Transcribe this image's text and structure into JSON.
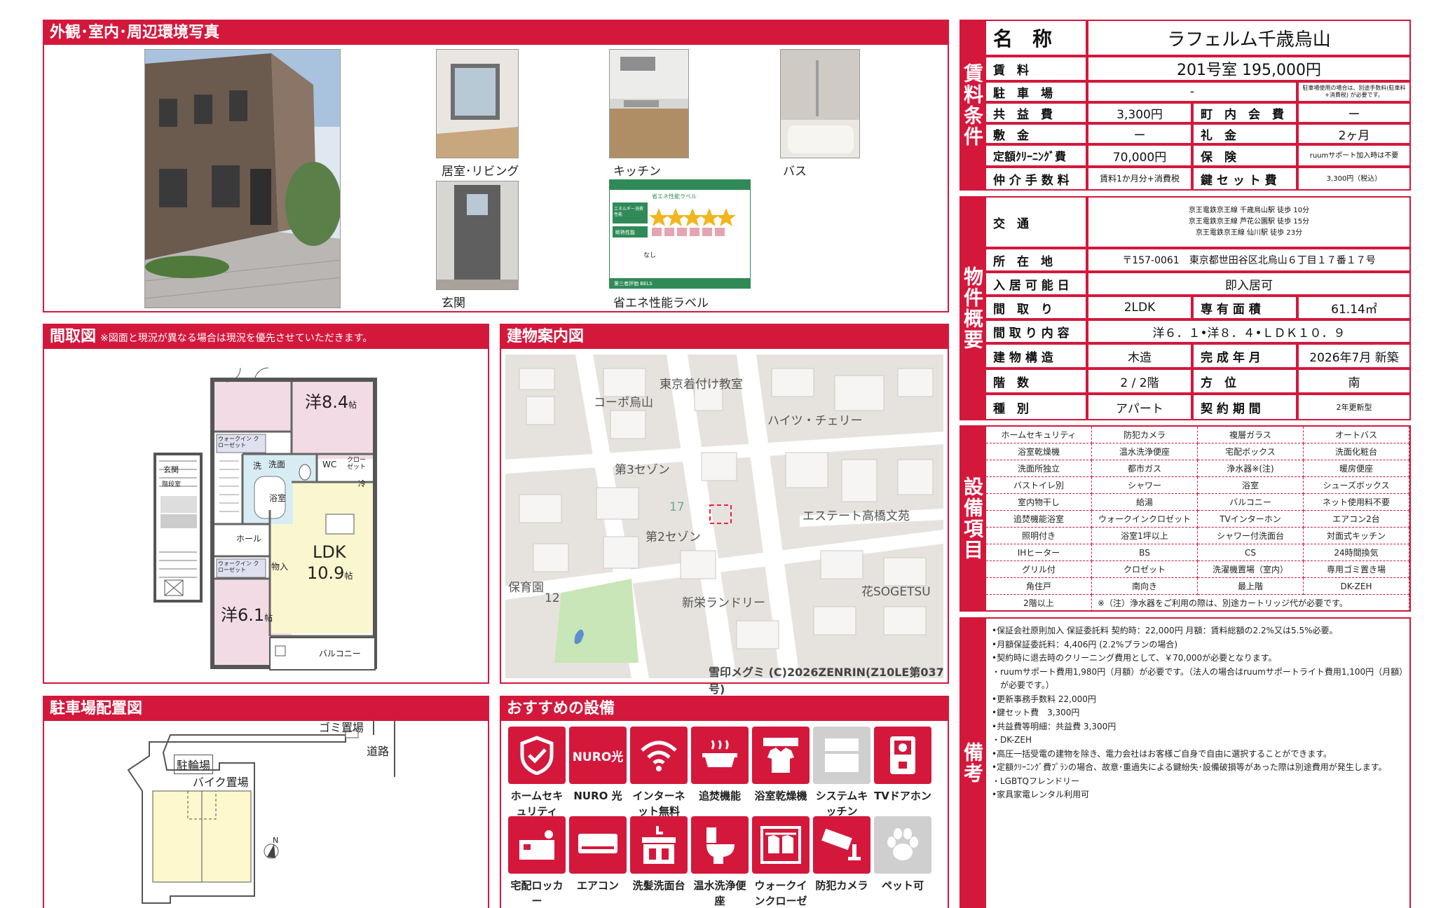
{
  "sections": {
    "photos_title": "外観･室内･周辺環境写真",
    "floorplan_title": "間取図",
    "floorplan_note": "※図面と現況が異なる場合は現況を優先させていただきます。",
    "map_title": "建物案内図",
    "parking_title": "駐車場配置図",
    "facilities_title": "おすすめの設備"
  },
  "photo_captions": {
    "living": "居室･リビング",
    "kitchen": "キッチン",
    "bath": "バス",
    "entrance": "玄関",
    "energy": "省エネ性能ラベル"
  },
  "energy_label": {
    "title": "省エネ性能ラベル",
    "row1": "エネルギー消費性能",
    "row2": "断熱性能",
    "none": "なし",
    "footer": "第三者評価 BELS"
  },
  "floorplan": {
    "room1": "洋8.4",
    "room1_unit": "帖",
    "room2": "洋6.1",
    "room2_unit": "帖",
    "ldk": "LDK",
    "ldk_size": "10.9",
    "ldk_unit": "帖",
    "wic1": "ウォークイン クローゼット",
    "wic2": "ウォークイン クローゼット",
    "wash": "洗",
    "basin": "洗面",
    "wc": "WC",
    "closet": "クロー ゼット",
    "fridge": "冷",
    "bath": "浴室",
    "hall": "ホール",
    "storage": "物入",
    "balcony": "バルコニー",
    "entrance": "玄関",
    "stairs": "階段室"
  },
  "map": {
    "labels": [
      "東京着付け教室",
      "コーポ烏山",
      "ハイツ・チェリー",
      "第3セゾン",
      "17",
      "エステート高橋文苑",
      "第2セゾン",
      "保育園",
      "12",
      "新栄ランドリー",
      "花SOGETSU"
    ],
    "copyright": "雪印メグミ (C)2026ZENRIN(Z10LE第037号)"
  },
  "parking": {
    "garbage": "ゴミ置場",
    "road": "道路",
    "bike": "駐輪場",
    "motorbike": "バイク置場",
    "north": "N"
  },
  "facility_icons": [
    {
      "label": "ホームセキュリティ",
      "icon": "shield-check-icon"
    },
    {
      "label": "NURO 光",
      "icon": "nuro-logo-icon",
      "glyph": "NURO光"
    },
    {
      "label": "インターネット無料",
      "icon": "wifi-icon"
    },
    {
      "label": "追焚機能",
      "icon": "bathtub-icon"
    },
    {
      "label": "浴室乾燥機",
      "icon": "bathroom-dryer-icon"
    },
    {
      "label": "システムキッチン",
      "icon": "kitchen-icon",
      "gray": true
    },
    {
      "label": "TVドアホン",
      "icon": "intercom-icon"
    },
    {
      "label": "宅配ロッカー",
      "icon": "delivery-locker-icon"
    },
    {
      "label": "エアコン",
      "icon": "air-conditioner-icon"
    },
    {
      "label": "洗髪洗面台",
      "icon": "vanity-icon"
    },
    {
      "label": "温水洗浄便座",
      "icon": "toilet-icon"
    },
    {
      "label": "ウォークインクローゼット",
      "icon": "closet-icon"
    },
    {
      "label": "防犯カメラ",
      "icon": "security-camera-icon"
    },
    {
      "label": "ペット可",
      "icon": "paw-icon",
      "gray": true
    }
  ],
  "colors": {
    "accent": "#d4183c",
    "gray_icon": "#cfcfcf",
    "paper": "#ffffff"
  },
  "rent": {
    "side": "賃料条件",
    "name_label": "名　称",
    "name": "ラフェルム千歳烏山",
    "rent_label": "賃　料",
    "rent": "201号室 195,000円",
    "parking_label": "駐　車　場",
    "parking": "-",
    "parking_note": "駐車場使用の場合は、別途手数料(駐車料+消費税) が必要です。",
    "common_label": "共　益　費",
    "common": "3,300円",
    "town_label": "町　内　会　費",
    "town": "ー",
    "deposit_label": "敷　金",
    "deposit": "ー",
    "key_label": "礼　金",
    "key": "2ヶ月",
    "cleaning_label": "定額ｸﾘｰﾆﾝｸﾞ費",
    "cleaning": "70,000円",
    "insurance_label": "保　険",
    "insurance": "ruumサポート加入時は不要",
    "brokerage_label": "仲 介 手 数 料",
    "brokerage": "賃料1か月分+消費税",
    "keyset_label": "鍵 セ ッ ト 費",
    "keyset": "3,300円（税込）"
  },
  "property": {
    "side": "物件概要",
    "transport_label": "交　通",
    "transport": [
      "京王電鉄京王線 千歳烏山駅 徒歩 10分",
      "京王電鉄京王線 芦花公園駅 徒歩 15分",
      "京王電鉄京王線 仙川駅 徒歩 23分"
    ],
    "address_label": "所　在　地",
    "address": "〒157-0061　東京都世田谷区北烏山６丁目１７番１７号",
    "movein_label": "入 居 可 能 日",
    "movein": "即入居可",
    "layout_label": "間　取　り",
    "layout": "2LDK",
    "area_label": "専 有 面 積",
    "area": "61.14㎡",
    "detail_label": "間 取 り 内 容",
    "detail": "洋６．１•洋８．４•ＬＤＫ１０．９",
    "structure_label": "建 物 構 造",
    "structure": "木造",
    "built_label": "完 成 年 月",
    "built": "2026年7月 新築",
    "floor_label": "階　数",
    "floor": "2 / 2階",
    "direction_label": "方　位",
    "direction": "南",
    "type_label": "種　別",
    "type": "アパート",
    "contract_label": "契 約 期 間",
    "contract": "2年更新型"
  },
  "equipment": {
    "side": "設備項目",
    "items": [
      "ホームセキュリティ",
      "防犯カメラ",
      "複層ガラス",
      "オートバス",
      "浴室乾燥機",
      "温水洗浄便座",
      "宅配ボックス",
      "洗面化粧台",
      "洗面所独立",
      "都市ガス",
      "浄水器※(注)",
      "暖房便座",
      "バストイレ別",
      "シャワー",
      "浴室",
      "シューズボックス",
      "室内物干し",
      "給湯",
      "バルコニー",
      "ネット使用料不要",
      "追焚機能浴室",
      "ウォークインクロゼット",
      "TVインターホン",
      "エアコン2台",
      "照明付き",
      "浴室1坪以上",
      "シャワー付洗面台",
      "対面式キッチン",
      "IHヒーター",
      "BS",
      "CS",
      "24時間換気",
      "グリル付",
      "クロゼット",
      "洗濯機置場（室内）",
      "専用ゴミ置き場",
      "角住戸",
      "南向き",
      "最上階",
      "DK-ZEH",
      "2階以上"
    ],
    "note": "※（注）浄水器をご利用の際は、別途カートリッジ代が必要です。"
  },
  "remarks": {
    "side": "備考",
    "lines": [
      "•保証会社原則加入 保証委託料 契約時：22,000円 月額：賃料総額の2.2%又は5.5%必要。",
      "•月額保証委託料：4,406円 (2.2%プランの場合)",
      "•契約時に退去時のクリーニング費用として、￥70,000が必要となります。",
      "・ruumサポート費用1,980円（月額）が必要です。（法人の場合はruumサポートライト費用1,100円（月額）",
      "　が必要です。）",
      "•更新事務手数料 22,000円",
      "•鍵セット費　3,300円",
      "•共益費等明細：共益費 3,300円",
      "・DK-ZEH",
      "•高圧一括受電の建物を除き、電力会社はお客様ご自身で自由に選択することができます。",
      "•定額ｸﾘｰﾆﾝｸﾞ費ﾌﾟﾗﾝの場合、故意･重過失による鍵紛失･設備破損等があった際は別途費用が発生します。",
      "・LGBTQフレンドリー",
      "•家具家電レンタル利用可"
    ]
  }
}
